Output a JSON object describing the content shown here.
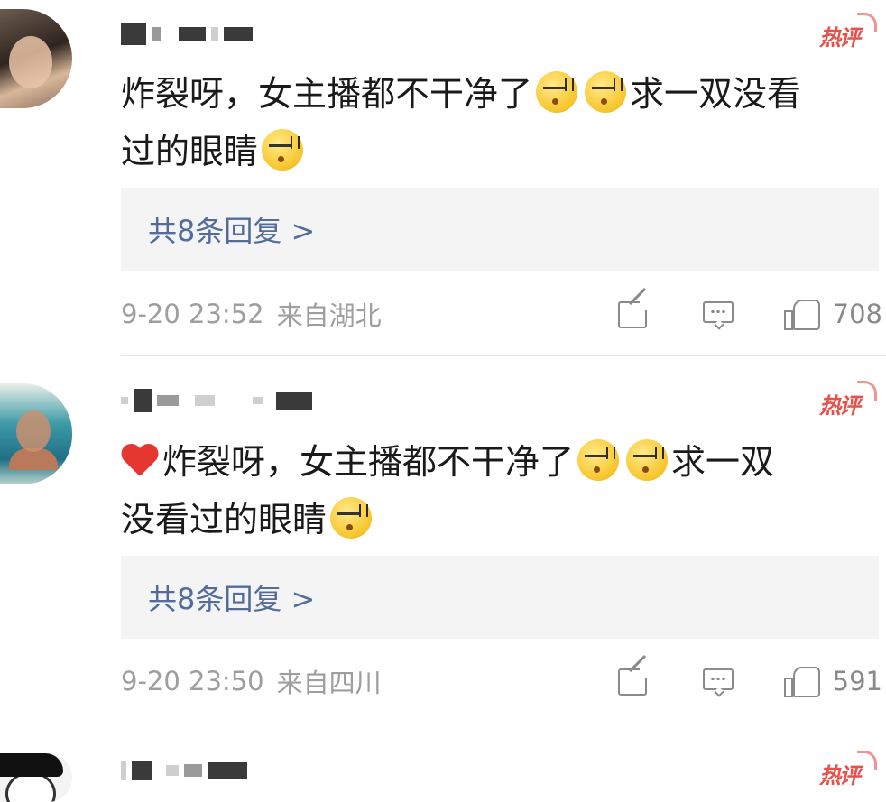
{
  "comments": [
    {
      "badge": "热评",
      "text_parts": [
        "炸裂呀，女主播都不干净了",
        "求一双没看",
        "过的眼睛"
      ],
      "replies_label": "共8条回复 >",
      "time": "9-20 23:52",
      "location": "来自湖北",
      "likes": "708"
    },
    {
      "badge": "热评",
      "text_parts": [
        "炸裂呀，女主播都不干净了",
        "求一双",
        "没看过的眼睛"
      ],
      "replies_label": "共8条回复 >",
      "time": "9-20 23:50",
      "location": "来自四川",
      "likes": "591"
    },
    {
      "badge": "热评"
    }
  ],
  "icons": {
    "emoji": "squint-sweat-emoji",
    "heart": "red-heart-emoji",
    "share": "share-icon",
    "comment": "comment-icon",
    "like": "thumbs-up-icon"
  },
  "colors": {
    "badge": "#e8504a",
    "link": "#526c9b",
    "meta": "#9e9e9e",
    "reply_bg": "#f4f4f4"
  }
}
